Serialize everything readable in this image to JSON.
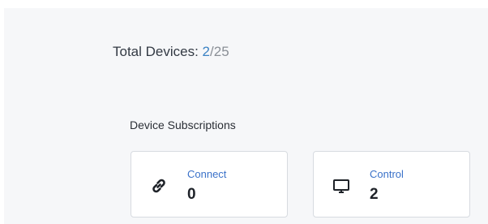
{
  "devices": {
    "label": "Total Devices: ",
    "count": "2",
    "separator": "/",
    "limit": "25"
  },
  "subscriptions": {
    "heading": "Device Subscriptions",
    "cards": [
      {
        "title": "Connect",
        "value": "0",
        "icon": "link-icon"
      },
      {
        "title": "Control",
        "value": "2",
        "icon": "monitor-icon"
      }
    ]
  },
  "colors": {
    "accent": "#3b82c4",
    "card_title": "#3b72c9",
    "panel_bg": "#f6f7f9"
  }
}
